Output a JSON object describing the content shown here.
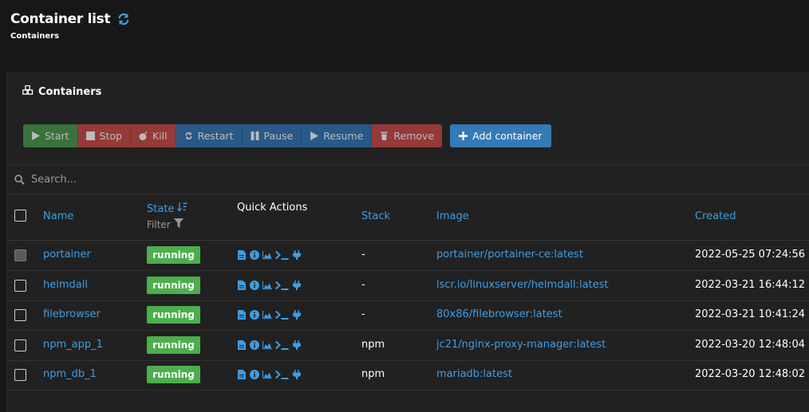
{
  "header": {
    "title": "Container list",
    "breadcrumb": "Containers"
  },
  "panel": {
    "title": "Containers"
  },
  "toolbar": {
    "start": "Start",
    "stop": "Stop",
    "kill": "Kill",
    "restart": "Restart",
    "pause": "Pause",
    "resume": "Resume",
    "remove": "Remove",
    "add": "Add container"
  },
  "search": {
    "placeholder": "Search..."
  },
  "columns": {
    "name": "Name",
    "state": "State",
    "state_filter": "Filter",
    "quick_actions": "Quick Actions",
    "stack": "Stack",
    "image": "Image",
    "created": "Created"
  },
  "quick_action_icons": [
    "file-icon",
    "info-icon",
    "stats-icon",
    "console-icon",
    "plug-icon"
  ],
  "colors": {
    "accent": "#3d9ee8",
    "running": "#4cae4c",
    "start": "#3f8a45",
    "danger": "#b84140",
    "primary": "#2c6aa6"
  },
  "rows": [
    {
      "name": "portainer",
      "state": "running",
      "stack": "-",
      "image": "portainer/portainer-ce:latest",
      "created": "2022-05-25 07:24:56"
    },
    {
      "name": "heimdall",
      "state": "running",
      "stack": "-",
      "image": "lscr.io/linuxserver/heimdall:latest",
      "created": "2022-03-21 16:44:12"
    },
    {
      "name": "filebrowser",
      "state": "running",
      "stack": "-",
      "image": "80x86/filebrowser:latest",
      "created": "2022-03-21 10:41:24"
    },
    {
      "name": "npm_app_1",
      "state": "running",
      "stack": "npm",
      "image": "jc21/nginx-proxy-manager:latest",
      "created": "2022-03-20 12:48:04"
    },
    {
      "name": "npm_db_1",
      "state": "running",
      "stack": "npm",
      "image": "mariadb:latest",
      "created": "2022-03-20 12:48:02"
    }
  ]
}
